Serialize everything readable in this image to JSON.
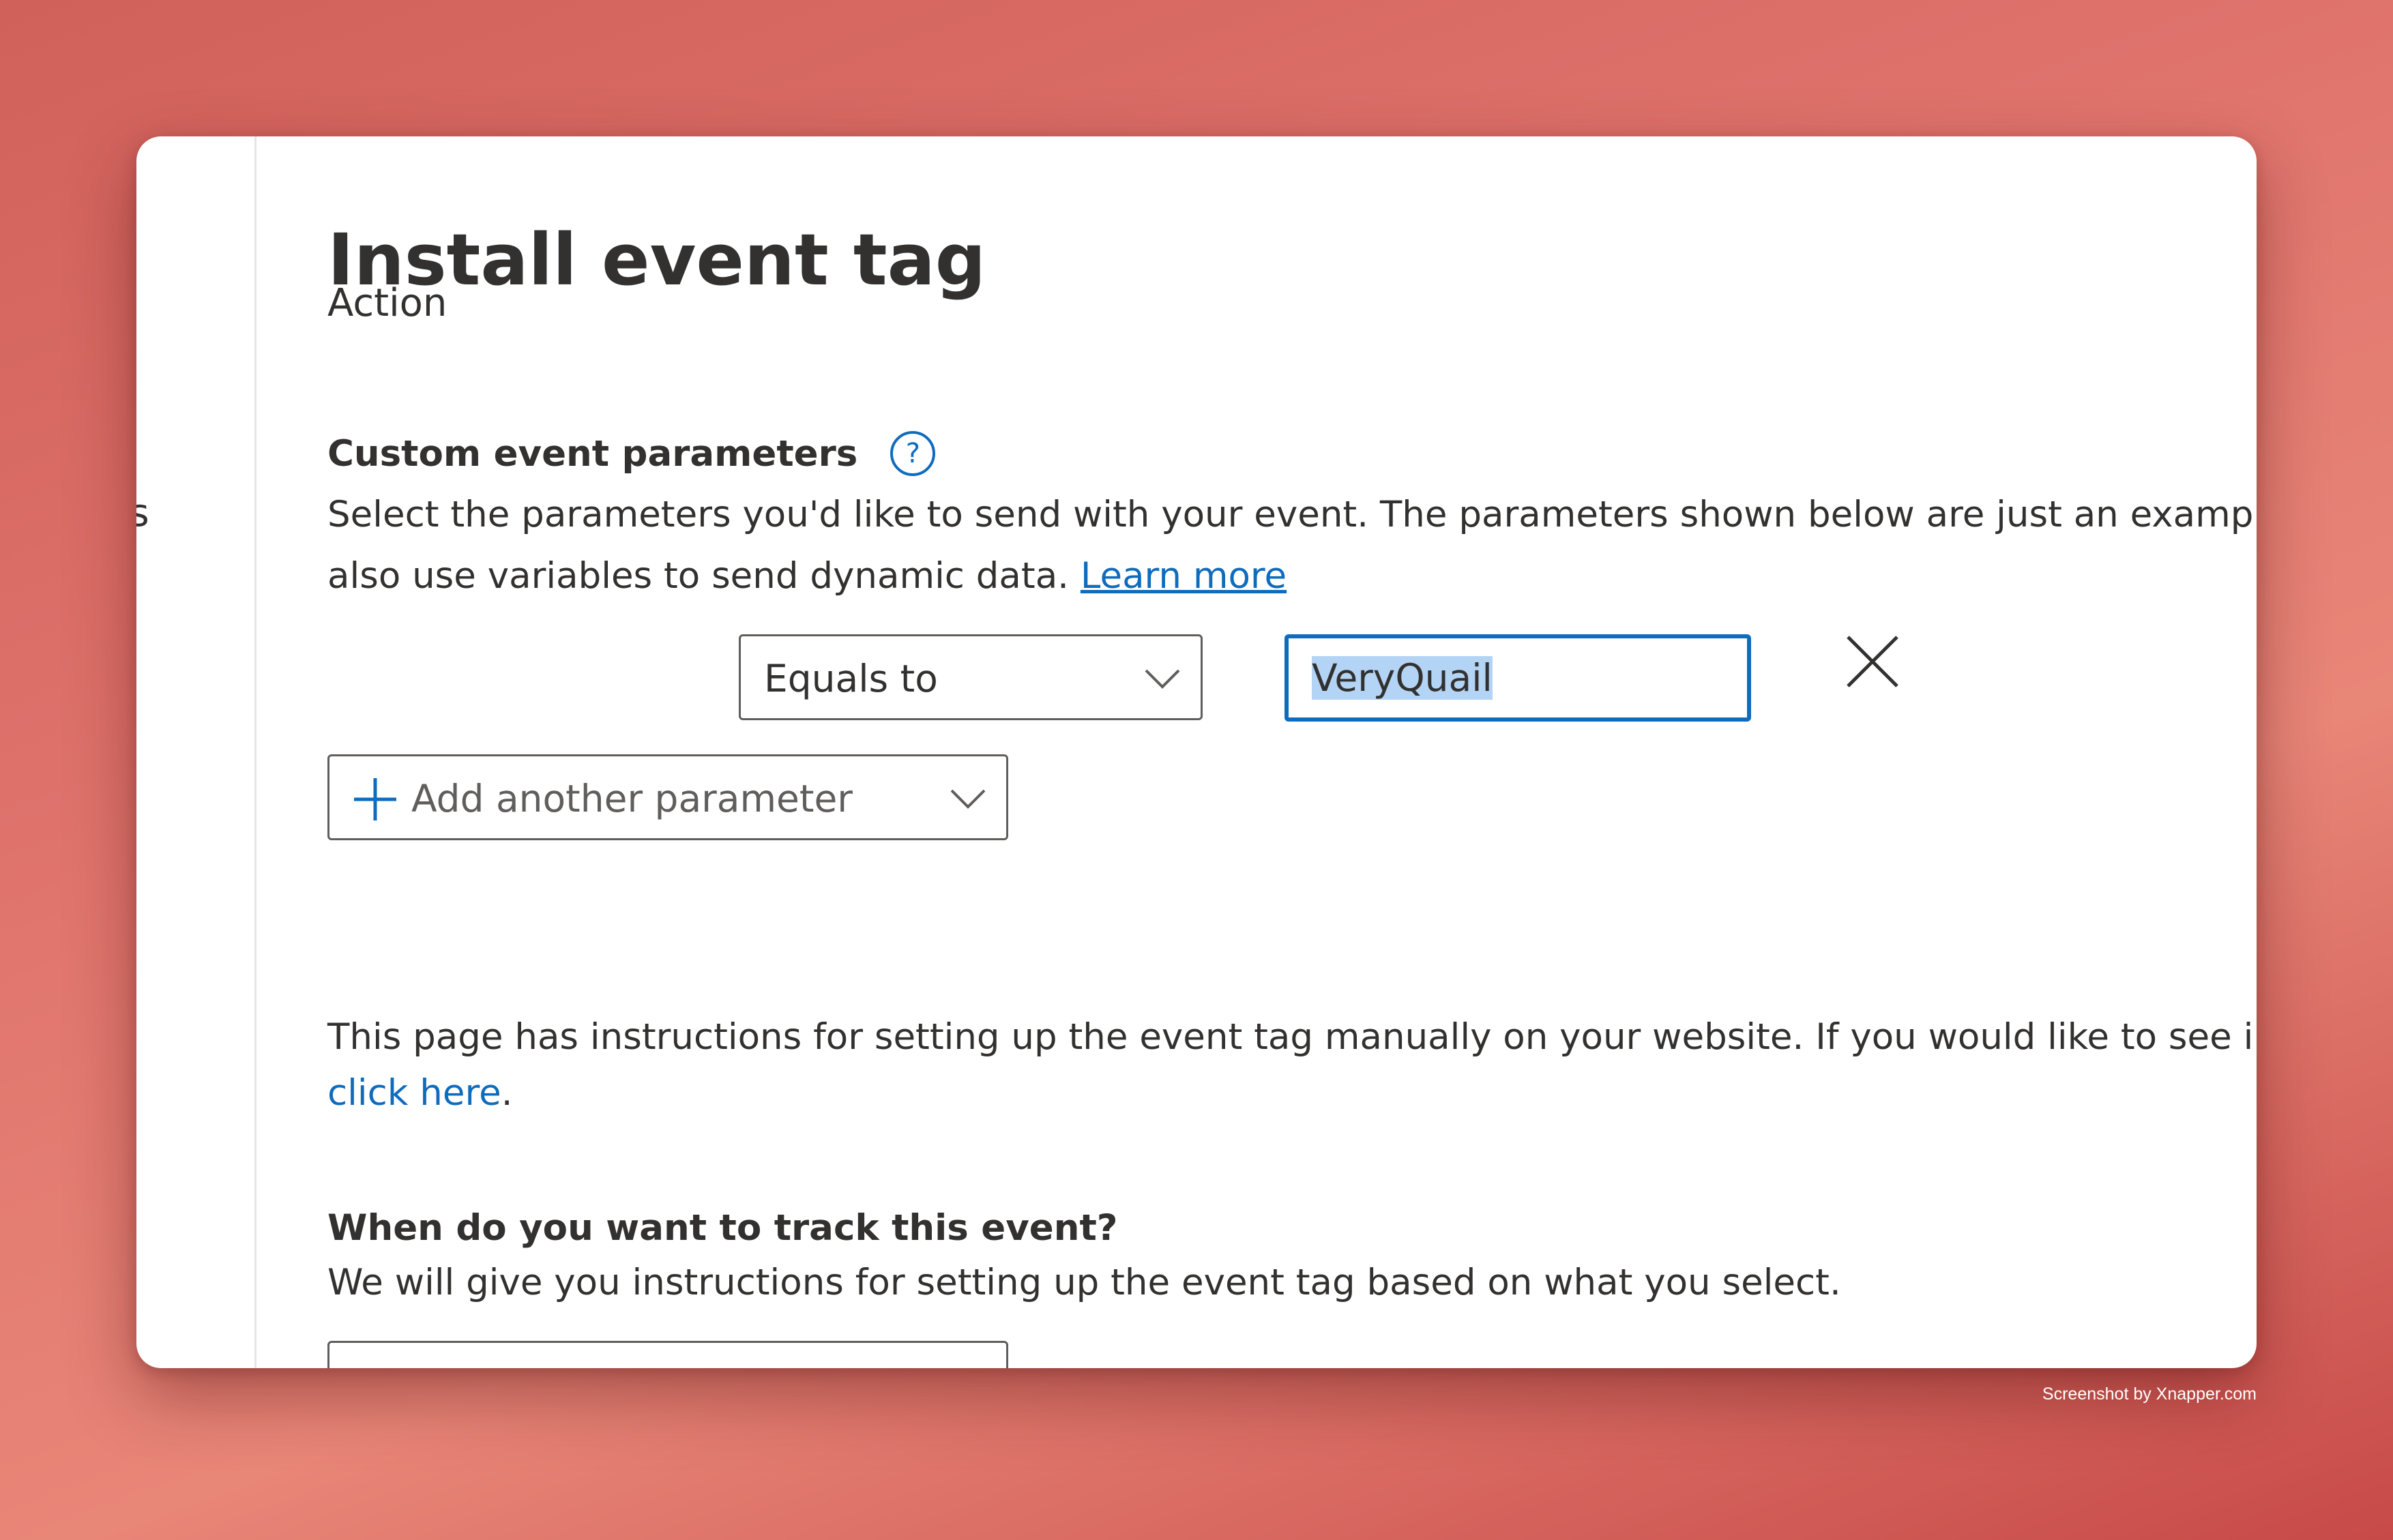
{
  "sidebar": {
    "cut_text": "ls"
  },
  "page": {
    "title": "Install event tag"
  },
  "custom_params": {
    "title": "Custom event parameters",
    "help_icon": "question-circle-icon",
    "desc_line1": "Select the parameters you'd like to send with your event. The parameters shown below are just an example. You ca",
    "desc_line2": "also use variables to send dynamic data. ",
    "learn_more": "Learn more",
    "rows": [
      {
        "label": "Action",
        "operator": "Equals to",
        "value": "VeryQuail"
      }
    ],
    "remove_icon": "close-icon",
    "add_label": "Add another parameter"
  },
  "instructions": {
    "line1": "This page has instructions for setting up the event tag manually on your website. If you would like to see instructio",
    "link": "click here",
    "after_link": "."
  },
  "track": {
    "title": "When do you want to track this event?",
    "desc": "We will give you instructions for setting up the event tag based on what you select."
  },
  "watermark": "Screenshot by Xnapper.com",
  "colors": {
    "accent": "#0f6cbd",
    "text": "#323130",
    "border": "#605e5c"
  }
}
